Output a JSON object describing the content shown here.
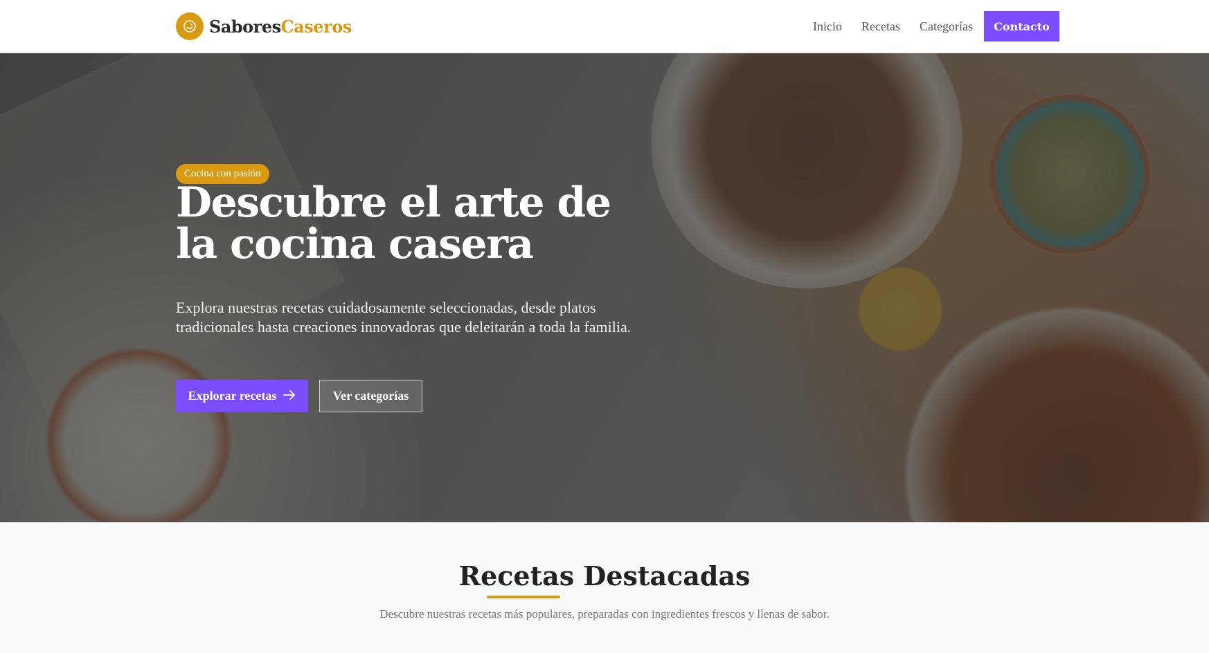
{
  "brand": {
    "name_part1": "Sabores",
    "name_part2": "Caseros",
    "accent_color": "#d99a12",
    "icon": "chef-smile-icon"
  },
  "nav": {
    "items": [
      {
        "label": "Inicio"
      },
      {
        "label": "Recetas"
      },
      {
        "label": "Categorías"
      }
    ],
    "cta_label": "Contacto",
    "cta_color": "#7c4dff"
  },
  "hero": {
    "badge": "Cocina con pasión",
    "title": "Descubre el arte de la cocina casera",
    "description": "Explora nuestras recetas cuidadosamente seleccionadas, desde platos tradicionales hasta creaciones innovadoras que deleitarán a toda la familia.",
    "primary_button": "Explorar recetas",
    "primary_icon": "arrow-right-icon",
    "secondary_button": "Ver categorías"
  },
  "featured": {
    "title": "Recetas Destacadas",
    "description": "Descubre nuestras recetas más populares, preparadas con ingredientes frescos y llenas de sabor."
  }
}
